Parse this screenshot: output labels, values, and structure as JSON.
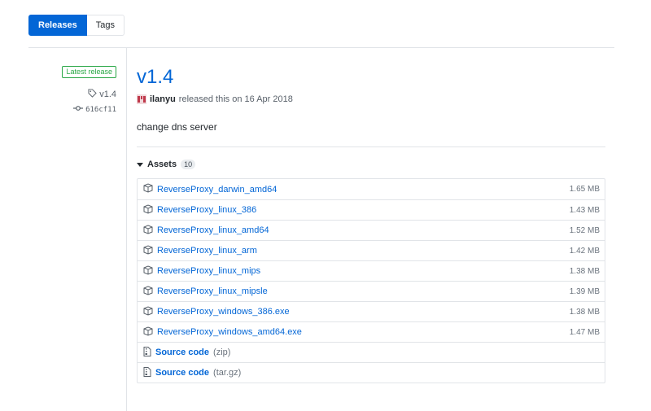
{
  "tabs": {
    "releases": "Releases",
    "tags": "Tags"
  },
  "sidebar": {
    "latest_label": "Latest release",
    "tag": "v1.4",
    "commit": "616cf11"
  },
  "release": {
    "title": "v1.4",
    "author": "ilanyu",
    "released_text": "released this on 16 Apr 2018",
    "body": "change dns server"
  },
  "assets": {
    "heading": "Assets",
    "count": "10",
    "files": [
      {
        "name": "ReverseProxy_darwin_amd64",
        "size": "1.65 MB"
      },
      {
        "name": "ReverseProxy_linux_386",
        "size": "1.43 MB"
      },
      {
        "name": "ReverseProxy_linux_amd64",
        "size": "1.52 MB"
      },
      {
        "name": "ReverseProxy_linux_arm",
        "size": "1.42 MB"
      },
      {
        "name": "ReverseProxy_linux_mips",
        "size": "1.38 MB"
      },
      {
        "name": "ReverseProxy_linux_mipsle",
        "size": "1.39 MB"
      },
      {
        "name": "ReverseProxy_windows_386.exe",
        "size": "1.38 MB"
      },
      {
        "name": "ReverseProxy_windows_amd64.exe",
        "size": "1.47 MB"
      }
    ],
    "sources": [
      {
        "label": "Source code",
        "suffix": "(zip)"
      },
      {
        "label": "Source code",
        "suffix": "(tar.gz)"
      }
    ]
  },
  "colors": {
    "accent": "#0366d6",
    "latest": "#28a745",
    "border": "#e1e4e8"
  }
}
